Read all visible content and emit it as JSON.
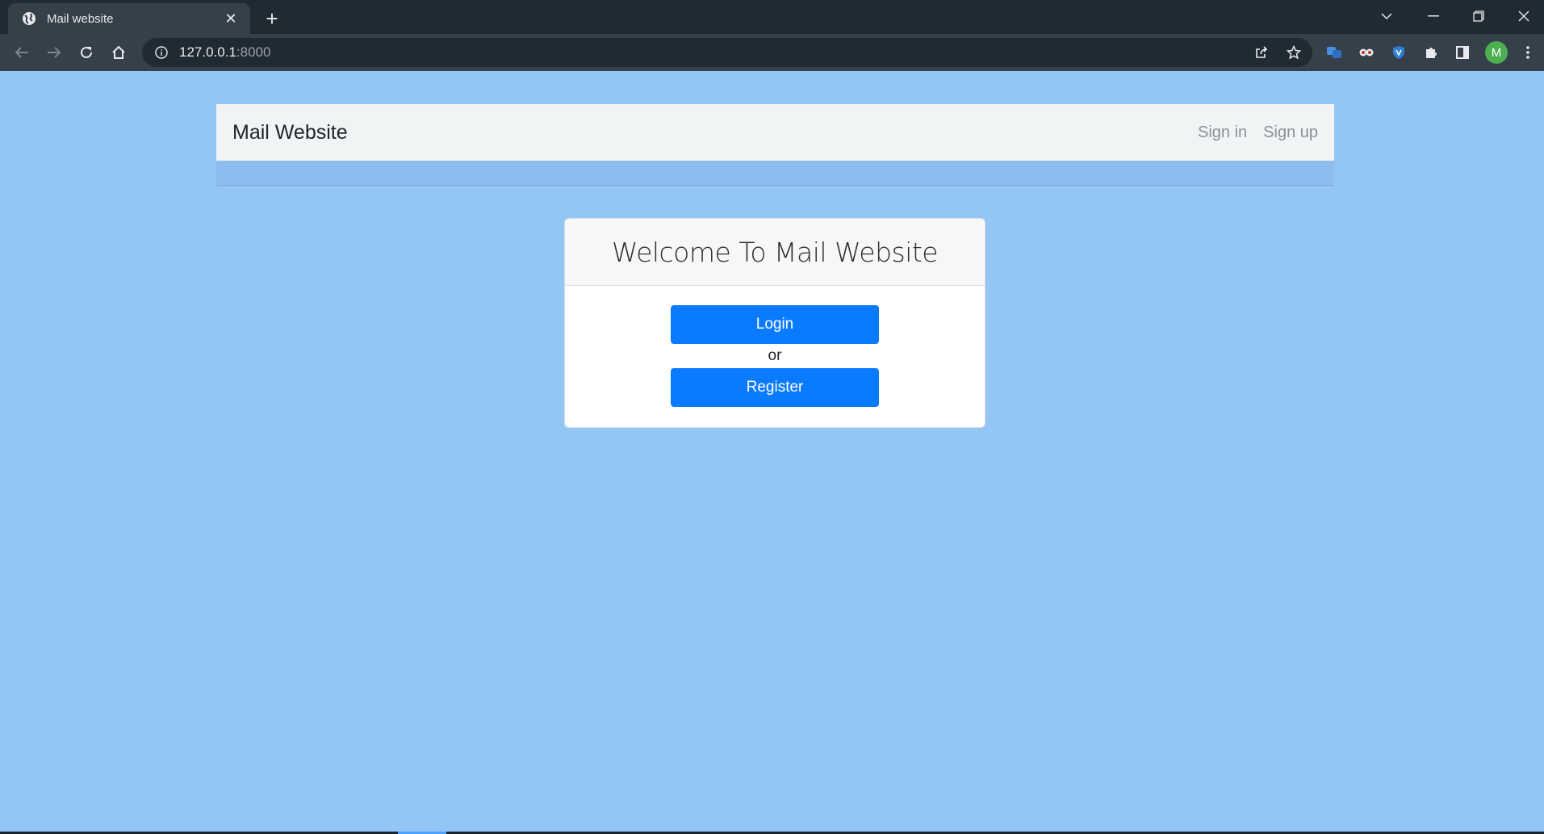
{
  "browser": {
    "tab_title": "Mail website",
    "url_host": "127.0.0.1",
    "url_port": ":8000",
    "profile_initial": "M"
  },
  "navbar": {
    "brand": "Mail Website",
    "sign_in": "Sign in",
    "sign_up": "Sign up"
  },
  "card": {
    "title": "Welcome To Mail Website",
    "login_label": "Login",
    "separator": "or",
    "register_label": "Register"
  },
  "colors": {
    "page_background": "#93c5f5",
    "primary_button": "#0a7bff",
    "navbar_background": "#f1f4f5"
  }
}
